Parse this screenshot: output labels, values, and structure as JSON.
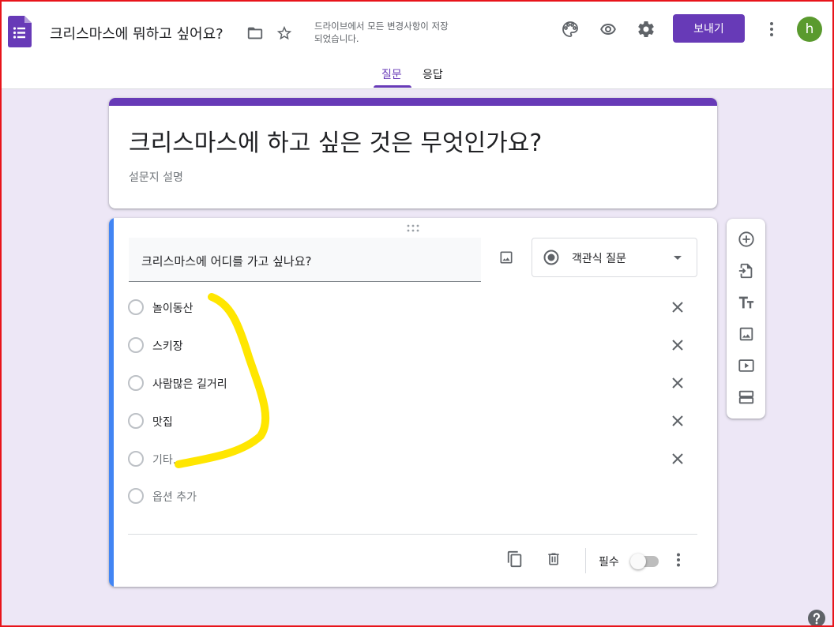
{
  "header": {
    "doc_title": "크리스마스에 뭐하고 싶어요?",
    "save_status": "드라이브에서 모든 변경사항이 저장되었습니다.",
    "send_label": "보내기",
    "avatar_initial": "h",
    "icons": [
      "forms-logo-icon",
      "folder-icon",
      "star-icon",
      "palette-icon",
      "eye-icon",
      "gear-icon",
      "more-vert-icon"
    ],
    "brand_color": "#673ab7"
  },
  "tabs": [
    {
      "label": "질문",
      "active": true
    },
    {
      "label": "응답",
      "active": false
    }
  ],
  "form": {
    "title": "크리스마스에 하고 싶은 것은 무엇인가요?",
    "description_placeholder": "설문지 설명"
  },
  "question": {
    "title": "크리스마스에 어디를 가고 싶나요?",
    "type_label": "객관식 질문",
    "options": [
      "놀이동산",
      "스키장",
      "사람많은 길거리",
      "맛집"
    ],
    "other_label": "기타...",
    "add_option_label": "옵션 추가",
    "required_label": "필수",
    "required": false,
    "accent_color": "#4285f4"
  },
  "side_toolbar": {
    "icons": [
      "add-question-icon",
      "import-questions-icon",
      "add-title-icon",
      "add-image-icon",
      "add-video-icon",
      "add-section-icon"
    ]
  }
}
